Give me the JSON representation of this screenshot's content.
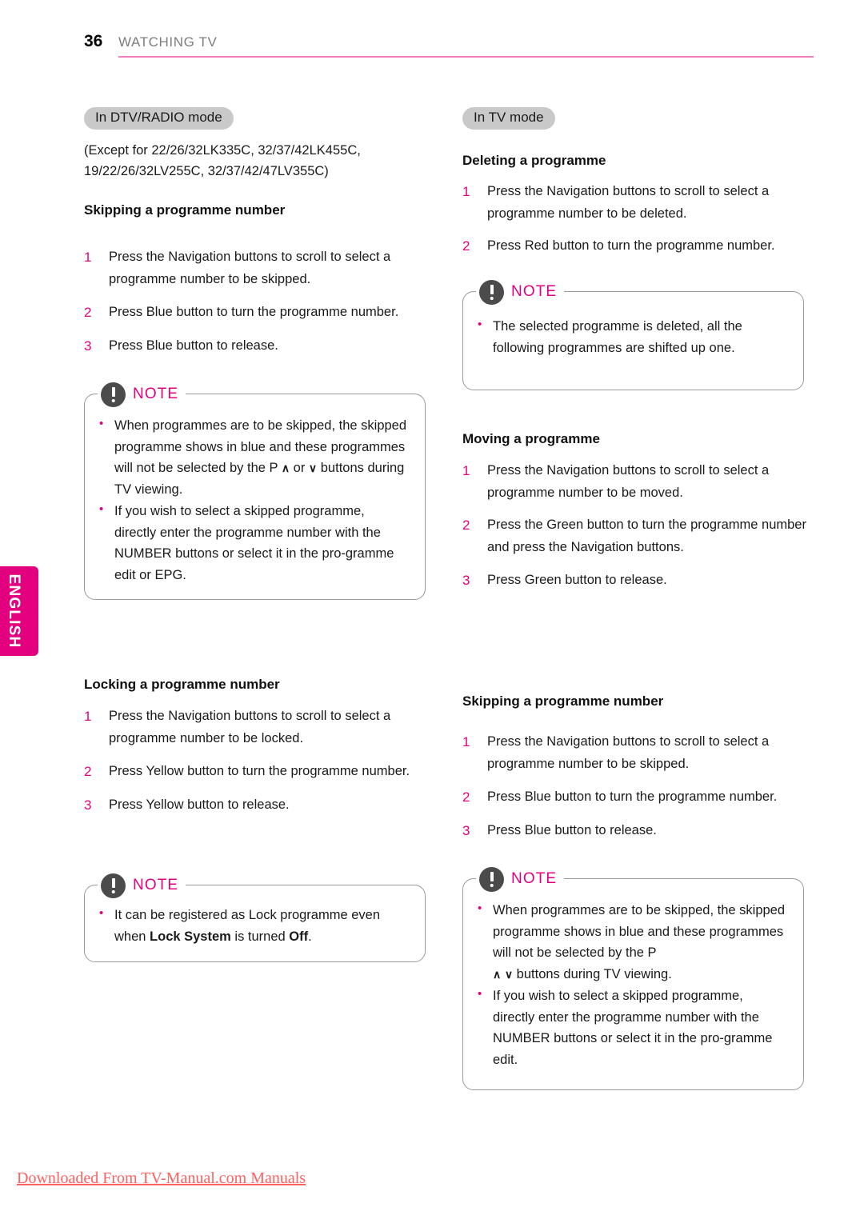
{
  "header": {
    "page_number": "36",
    "title": "WATCHING TV",
    "rule_color": "#ef7fbd"
  },
  "language_tab": {
    "label": "ENGLISH",
    "color": "#e2007f"
  },
  "colors": {
    "accent": "#e2007f",
    "pill_bg": "#c9c9c9",
    "note_border": "#9a9a9a",
    "note_icon": "#4b4b4b",
    "watermark": "#ff6060"
  },
  "left_column": {
    "mode_pill": "In DTV/RADIO mode",
    "except_line1": "(Except for 22/26/32LK335C, 32/37/42LK455C,",
    "except_line2": "19/22/26/32LV255C, 32/37/42/47LV355C)",
    "section1": {
      "heading": "Skipping a programme number",
      "steps": [
        {
          "num": "1",
          "text": "Press the Navigation buttons to scroll to select a programme number to be skipped."
        },
        {
          "num": "2",
          "text": "Press Blue button to turn the programme number."
        },
        {
          "num": "3",
          "text": "Press Blue button to release."
        }
      ],
      "note": {
        "label": "NOTE",
        "bullets": [
          {
            "part1": "When programmes are to be skipped, the skipped programme shows in blue and these programmes will not be selected by the P ",
            "arrow1": "∧",
            "part2": " or ",
            "arrow2": "∨",
            "part3": " buttons during TV viewing."
          },
          {
            "part1": "If you wish to select a skipped programme, directly enter the programme number with the NUMBER buttons or select it in the pro-gramme edit or EPG."
          }
        ]
      }
    },
    "section2": {
      "heading": "Locking a programme number",
      "steps": [
        {
          "num": "1",
          "text": "Press the Navigation buttons to scroll to select a programme number to be locked."
        },
        {
          "num": "2",
          "text": "Press Yellow button  to turn the programme number."
        },
        {
          "num": "3",
          "text": "Press Yellow button  to release."
        }
      ],
      "note": {
        "label": "NOTE",
        "bullet_pre": "It can be registered as Lock programme even when ",
        "bullet_bold1": "Lock System",
        "bullet_mid": " is turned ",
        "bullet_bold2": "Off",
        "bullet_post": "."
      }
    }
  },
  "right_column": {
    "mode_pill": "In TV mode",
    "section1": {
      "heading": "Deleting a programme",
      "steps": [
        {
          "num": "1",
          "text": "Press the Navigation buttons to scroll to select a programme number to be deleted."
        },
        {
          "num": "2",
          "text": "Press Red button  to turn the programme number."
        }
      ],
      "note": {
        "label": "NOTE",
        "bullet": "The selected programme is deleted, all the following programmes are shifted up one."
      }
    },
    "section2": {
      "heading": "Moving a programme",
      "steps": [
        {
          "num": "1",
          "text": "Press the Navigation buttons to scroll to select a programme number to be moved."
        },
        {
          "num": "2",
          "text": "Press the Green button to turn the programme number and press the Navigation buttons."
        },
        {
          "num": "3",
          "text": "Press Green button to release."
        }
      ]
    },
    "section3": {
      "heading": "Skipping a programme number",
      "steps": [
        {
          "num": "1",
          "text": "Press the Navigation buttons to scroll to select a programme number to be skipped."
        },
        {
          "num": "2",
          "text": "Press Blue button to turn the programme number."
        },
        {
          "num": "3",
          "text": "Press Blue button to release."
        }
      ],
      "note": {
        "label": "NOTE",
        "bullets": [
          {
            "part1": "When programmes are to be skipped, the skipped programme shows in blue and these programmes will not be selected by the P",
            "arrow1": "∧",
            "arrow2": "∨",
            "part3": " buttons during TV viewing."
          },
          {
            "part1": "If you wish to select a skipped programme, directly enter the programme number with the NUMBER buttons or select it in the pro-gramme edit."
          }
        ]
      }
    }
  },
  "footer": {
    "watermark": "Downloaded From TV-Manual.com Manuals"
  }
}
